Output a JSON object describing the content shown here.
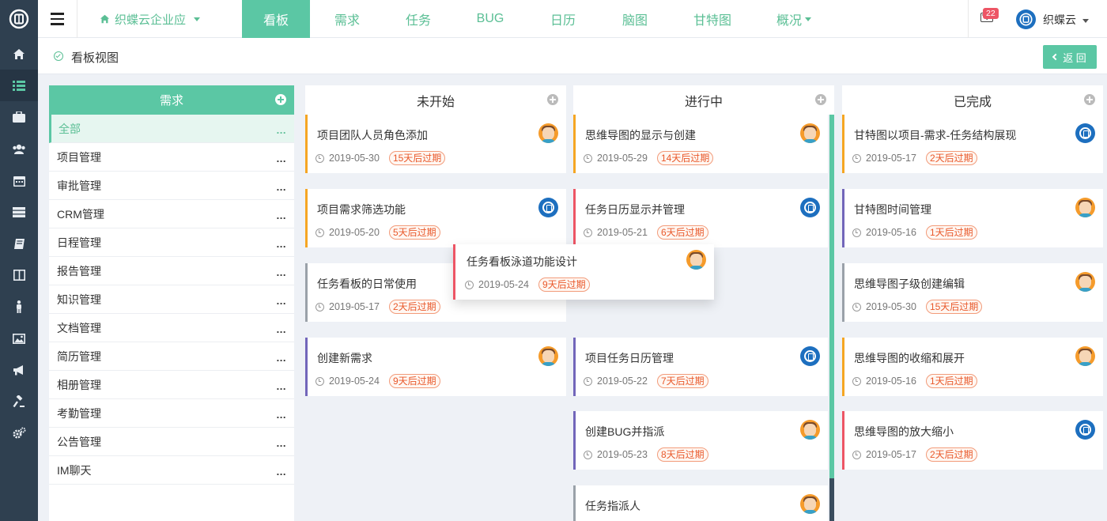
{
  "sidebar_icons": [
    "home-icon",
    "list-icon",
    "briefcase-icon",
    "users-icon",
    "calendar-icon",
    "server-icon",
    "book-icon",
    "columns-icon",
    "person-icon",
    "image-icon",
    "megaphone-icon",
    "gavel-icon",
    "gears-icon"
  ],
  "topbar": {
    "company": "织蝶云企业应",
    "tabs": [
      "看板",
      "需求",
      "任务",
      "BUG",
      "日历",
      "脑图",
      "甘特图",
      "概况"
    ],
    "active_tab": "看板",
    "notification_count": "22",
    "username": "织蝶云"
  },
  "subheader": {
    "title": "看板视图",
    "back_label": "返 回"
  },
  "categories": {
    "title": "需求",
    "items": [
      "全部",
      "项目管理",
      "审批管理",
      "CRM管理",
      "日程管理",
      "报告管理",
      "知识管理",
      "文档管理",
      "简历管理",
      "相册管理",
      "考勤管理",
      "公告管理",
      "IM聊天"
    ],
    "more": "..."
  },
  "columns": [
    {
      "title": "未开始",
      "cards": [
        {
          "title": "项目团队人员角色添加",
          "date": "2019-05-30",
          "due": "15天后过期",
          "avatar": "person"
        },
        {
          "title": "项目需求筛选功能",
          "date": "2019-05-20",
          "due": "5天后过期",
          "avatar": "logo"
        },
        {
          "title": "任务看板的日常使用",
          "date": "2019-05-17",
          "due": "2天后过期",
          "avatar": "person"
        },
        {
          "title": "创建新需求",
          "date": "2019-05-24",
          "due": "9天后过期",
          "avatar": "person"
        }
      ]
    },
    {
      "title": "进行中",
      "cards": [
        {
          "title": "思维导图的显示与创建",
          "date": "2019-05-29",
          "due": "14天后过期",
          "avatar": "person"
        },
        {
          "title": "任务日历显示并管理",
          "date": "2019-05-21",
          "due": "6天后过期",
          "avatar": "logo"
        },
        {
          "title": "项目任务日历管理",
          "date": "2019-05-22",
          "due": "7天后过期",
          "avatar": "logo"
        },
        {
          "title": "创建BUG并指派",
          "date": "2019-05-23",
          "due": "8天后过期",
          "avatar": "person"
        },
        {
          "title": "任务指派人",
          "date": "",
          "due": "",
          "avatar": "person"
        }
      ]
    },
    {
      "title": "已完成",
      "cards": [
        {
          "title": "甘特图以项目-需求-任务结构展现",
          "date": "2019-05-17",
          "due": "2天后过期",
          "avatar": "logo"
        },
        {
          "title": "甘特图时间管理",
          "date": "2019-05-16",
          "due": "1天后过期",
          "avatar": "person"
        },
        {
          "title": "思维导图子级创建编辑",
          "date": "2019-05-30",
          "due": "15天后过期",
          "avatar": "person"
        },
        {
          "title": "思维导图的收缩和展开",
          "date": "2019-05-16",
          "due": "1天后过期",
          "avatar": "person"
        },
        {
          "title": "思维导图的放大缩小",
          "date": "2019-05-17",
          "due": "2天后过期",
          "avatar": "logo"
        }
      ]
    }
  ],
  "dragging_card": {
    "title": "任务看板泳道功能设计",
    "date": "2019-05-24",
    "due": "9天后过期",
    "avatar": "person"
  }
}
